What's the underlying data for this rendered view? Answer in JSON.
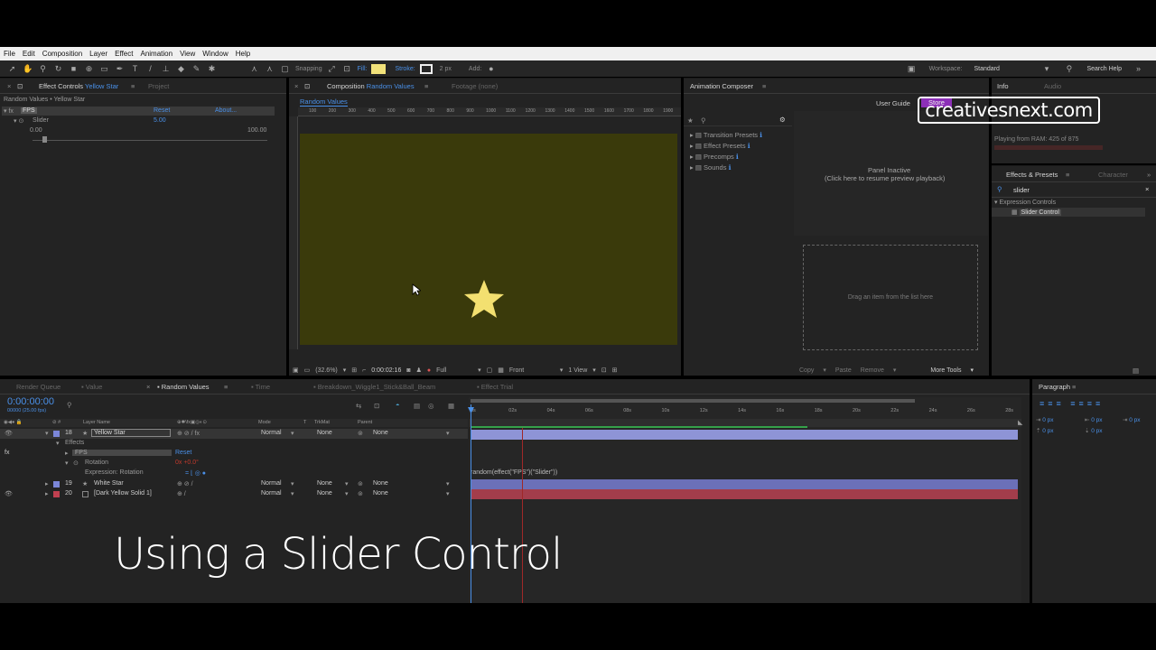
{
  "menu": [
    "File",
    "Edit",
    "Composition",
    "Layer",
    "Effect",
    "Animation",
    "View",
    "Window",
    "Help"
  ],
  "toolbar": {
    "snapping": "Snapping",
    "fill": "Fill:",
    "stroke": "Stroke:",
    "stroke_width": "2 px",
    "add": "Add:",
    "workspace_label": "Workspace:",
    "workspace_value": "Standard",
    "search_help": "Search Help",
    "fill_color": "#f2e27a"
  },
  "effect_controls": {
    "tab_prefix": "Effect Controls",
    "tab_layer": "Yellow Star",
    "project_tab": "Project",
    "breadcrumb": "Random Values • Yellow Star",
    "effect_name": "FPS",
    "reset": "Reset",
    "about": "About...",
    "slider_label": "Slider",
    "slider_value": "5.00",
    "slider_min": "0.00",
    "slider_max": "100.00",
    "slider_level": 0.05
  },
  "composition": {
    "tab_prefix": "Composition",
    "tab_name": "Random Values",
    "footage_tab": "Footage (none)",
    "subtab": "Random Values",
    "ruler_ticks": [
      "100",
      "200",
      "300",
      "400",
      "500",
      "600",
      "700",
      "800",
      "900",
      "1000",
      "1100",
      "1200",
      "1300",
      "1400",
      "1500",
      "1600",
      "1700",
      "1800",
      "1900"
    ],
    "zoom": "(32.6%)",
    "timecode": "0:00:02:16",
    "resolution": "Full",
    "view": "Front",
    "views": "1 View",
    "bg_color": "#3a3a0b"
  },
  "animation_composer": {
    "title": "Animation Composer",
    "user_guide": "User Guide",
    "store": "Store",
    "items": [
      "Transition Presets",
      "Effect Presets",
      "Precomps",
      "Sounds"
    ],
    "panel_inactive": "Panel Inactive",
    "resume_hint": "(Click here to resume preview playback)",
    "drag_hint": "Drag an item from the list here",
    "copy": "Copy",
    "paste": "Paste",
    "remove": "Remove",
    "more_tools": "More Tools"
  },
  "info": {
    "info_tab": "Info",
    "audio_tab": "Audio",
    "playing": "Playing from RAM: 425 of 875"
  },
  "effects_presets": {
    "tab": "Effects & Presets",
    "character_tab": "Character",
    "search_value": "slider",
    "category": "Expression Controls",
    "result": "Slider Control"
  },
  "logo": "creativesnext.com",
  "timeline": {
    "tabs": [
      "Render Queue",
      "Value",
      "Random Values",
      "Time",
      "Breakdown_Wiggle1_Stick&Ball_Beam",
      "Effect Trial"
    ],
    "timecode": "0:00:00:00",
    "fps_note": "00000 (25.00 fps)",
    "col_layer_name": "Layer Name",
    "col_mode": "Mode",
    "col_t": "T",
    "col_trkmat": "TrkMat",
    "col_parent": "Parent",
    "ticks": [
      "0s",
      "02s",
      "04s",
      "06s",
      "08s",
      "10s",
      "12s",
      "14s",
      "16s",
      "18s",
      "20s",
      "22s",
      "24s",
      "26s",
      "28s"
    ],
    "layers": [
      {
        "num": "18",
        "name": "Yellow Star",
        "mode": "Normal",
        "trkmat": "",
        "parent": "None",
        "color": "#7b86d8",
        "bar": "#8e94d6"
      },
      {
        "num": "19",
        "name": "White Star",
        "mode": "Normal",
        "trkmat": "None",
        "parent": "None",
        "color": "#7b86d8",
        "bar": "#6b70b8"
      },
      {
        "num": "20",
        "name": "[Dark Yellow Solid 1]",
        "mode": "Normal",
        "trkmat": "None",
        "parent": "None",
        "color": "#c04050",
        "bar": "#a33d4b"
      }
    ],
    "effects_label": "Effects",
    "fps_effect": "FPS",
    "reset": "Reset",
    "rotation": "Rotation",
    "rotation_value": "0x +0.0°",
    "expression_label": "Expression: Rotation",
    "expression": "random(effect(\"FPS\")(\"Slider\"))"
  },
  "paragraph": {
    "title": "Paragraph",
    "fields": [
      "0 px",
      "0 px",
      "0 px",
      "0 px",
      "0 px"
    ]
  },
  "overlay": "Using a Slider Control"
}
